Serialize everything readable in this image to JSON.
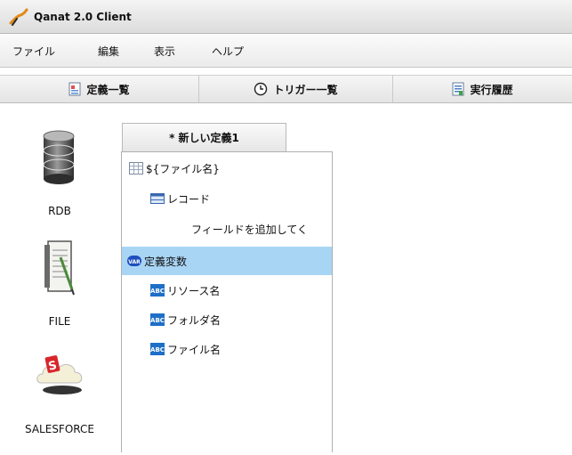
{
  "window": {
    "title": "Qanat 2.0 Client",
    "app_icon": "qanat-logo-icon"
  },
  "menu": {
    "items": [
      "ファイル",
      "編集",
      "表示",
      "ヘルプ"
    ]
  },
  "toolbar": {
    "buttons": [
      {
        "label": "定義一覧",
        "icon": "document-list-icon"
      },
      {
        "label": "トリガー一覧",
        "icon": "clock-icon"
      },
      {
        "label": "実行履歴",
        "icon": "history-report-icon"
      }
    ]
  },
  "palette": {
    "items": [
      {
        "label": "RDB",
        "icon": "database-icon"
      },
      {
        "label": "FILE",
        "icon": "file-icon"
      },
      {
        "label": "SALESFORCE",
        "icon": "salesforce-cloud-icon"
      }
    ]
  },
  "editor": {
    "tab_label": "* 新しい定義1",
    "tree": {
      "root_label": "${ファイル名}",
      "record_label": "レコード",
      "add_field_hint": "フィールドを追加してく",
      "variables_label": "定義変数",
      "variables": [
        "リソース名",
        "フォルダ名",
        "ファイル名"
      ]
    }
  },
  "colors": {
    "selected_row": "#a9d5f5",
    "abc_badge": "#1e6fc7",
    "var_badge": "#1d4fbf"
  }
}
